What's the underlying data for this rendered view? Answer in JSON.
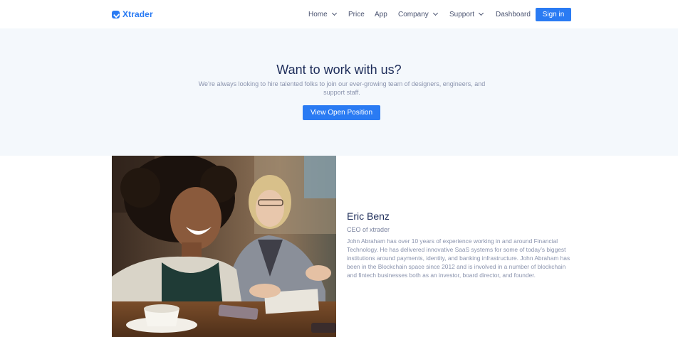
{
  "brand": {
    "name": "Xtrader",
    "accent": "#2a7bf3"
  },
  "nav": {
    "items": [
      {
        "label": "Home",
        "has_dropdown": true
      },
      {
        "label": "Price",
        "has_dropdown": false
      },
      {
        "label": "App",
        "has_dropdown": false
      },
      {
        "label": "Company",
        "has_dropdown": true
      },
      {
        "label": "Support",
        "has_dropdown": true
      },
      {
        "label": "Dashboard",
        "has_dropdown": false
      }
    ],
    "signin_label": "Sign in"
  },
  "hero": {
    "title": "Want to work with us?",
    "subtitle": "We’re always looking to hire talented folks to join our ever-growing team of designers, engineers, and support staff.",
    "button_label": "View Open Position"
  },
  "team": {
    "name": "Eric Benz",
    "role": "CEO of xtrader",
    "bio": "John Abraham has over 10 years of experience working in and around Financial Technology. He has delivered innovative SaaS systems for some of today’s biggest institutions around payments, identity, and banking infrastructure. John Abraham has been in the Blockchain space since 2012 and is involved in a number of blockchain and fintech businesses both as an investor, board director, and founder.",
    "photo_icon": "team-photo"
  }
}
